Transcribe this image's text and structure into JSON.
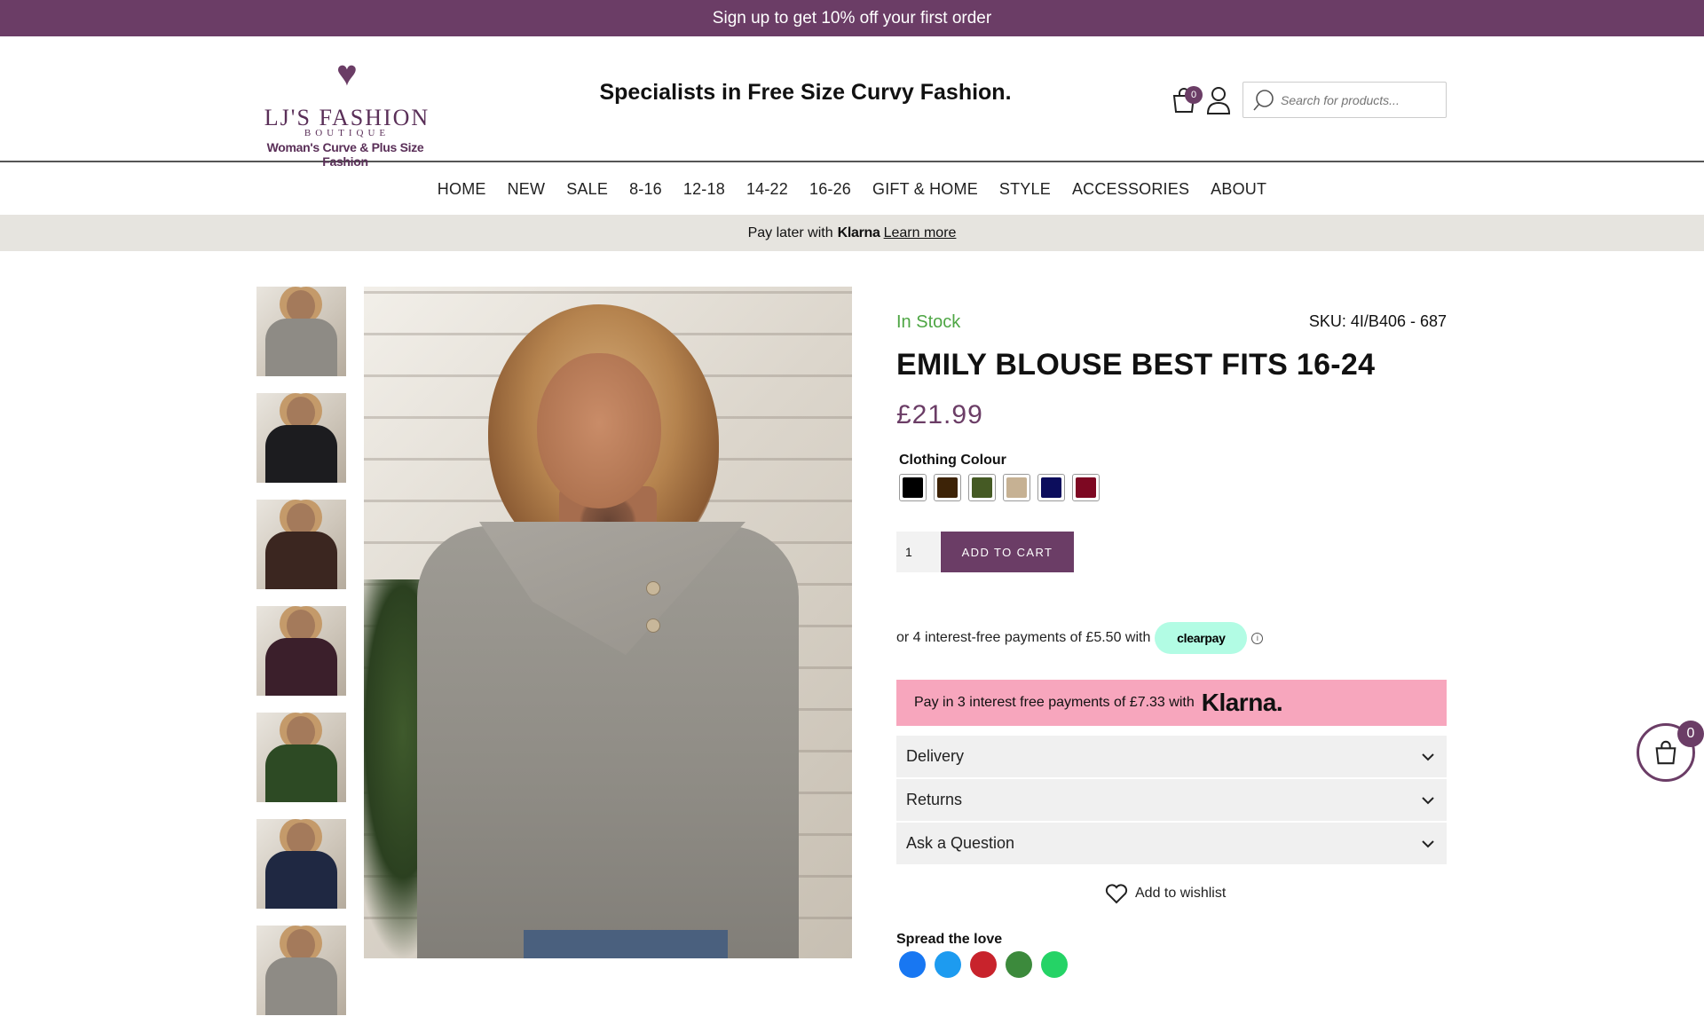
{
  "announcement": {
    "text": "Sign up to get 10% off your first order"
  },
  "header": {
    "logo": {
      "main": "LJ'S FASHION",
      "sub": "BOUTIQUE",
      "tag": "Woman's Curve & Plus Size Fashion"
    },
    "tagline": "Specialists in Free Size Curvy Fashion.",
    "cart_count": "0",
    "search": {
      "placeholder": "Search for products..."
    }
  },
  "nav": {
    "items": [
      {
        "label": "HOME"
      },
      {
        "label": "NEW"
      },
      {
        "label": "SALE"
      },
      {
        "label": "8-16"
      },
      {
        "label": "12-18"
      },
      {
        "label": "14-22"
      },
      {
        "label": "16-26"
      },
      {
        "label": "GIFT & HOME"
      },
      {
        "label": "STYLE"
      },
      {
        "label": "ACCESSORIES"
      },
      {
        "label": "ABOUT"
      }
    ]
  },
  "klarna_bar": {
    "prefix": "Pay later with",
    "brand": "Klarna",
    "link": "Learn more"
  },
  "gallery": {
    "thumb_colors": [
      "#8e8b85",
      "#1c1c1f",
      "#3b2620",
      "#3b1f2b",
      "#2d4a24",
      "#1f2842",
      "#8e8b85"
    ]
  },
  "product": {
    "stock": "In Stock",
    "sku": "SKU: 4I/B406 - 687",
    "title": "EMILY BLOUSE BEST FITS 16-24",
    "price": "£21.99",
    "colour_label": "Clothing Colour",
    "swatches": [
      {
        "name": "black",
        "color": "#000000"
      },
      {
        "name": "brown",
        "color": "#3d2307"
      },
      {
        "name": "khaki",
        "color": "#455a24"
      },
      {
        "name": "stone",
        "color": "#c6b193"
      },
      {
        "name": "navy",
        "color": "#0c0d5c"
      },
      {
        "name": "wine",
        "color": "#7d0822"
      }
    ],
    "quantity": "1",
    "add_to_cart": "ADD TO CART",
    "clearpay": {
      "text": "or 4 interest-free payments of £5.50 with",
      "brand": "clearpay",
      "info": "i"
    },
    "klarna": {
      "text": "Pay in 3 interest free payments of £7.33 with",
      "brand": "Klarna."
    },
    "accordion": [
      {
        "label": "Delivery"
      },
      {
        "label": "Returns"
      },
      {
        "label": "Ask a Question"
      }
    ],
    "wishlist": "Add to wishlist",
    "spread": "Spread the love",
    "social_colors": [
      "#1877f2",
      "#1d9bf0",
      "#c8232c",
      "#3c8a3c",
      "#25d366"
    ]
  },
  "floating_cart": {
    "count": "0"
  }
}
